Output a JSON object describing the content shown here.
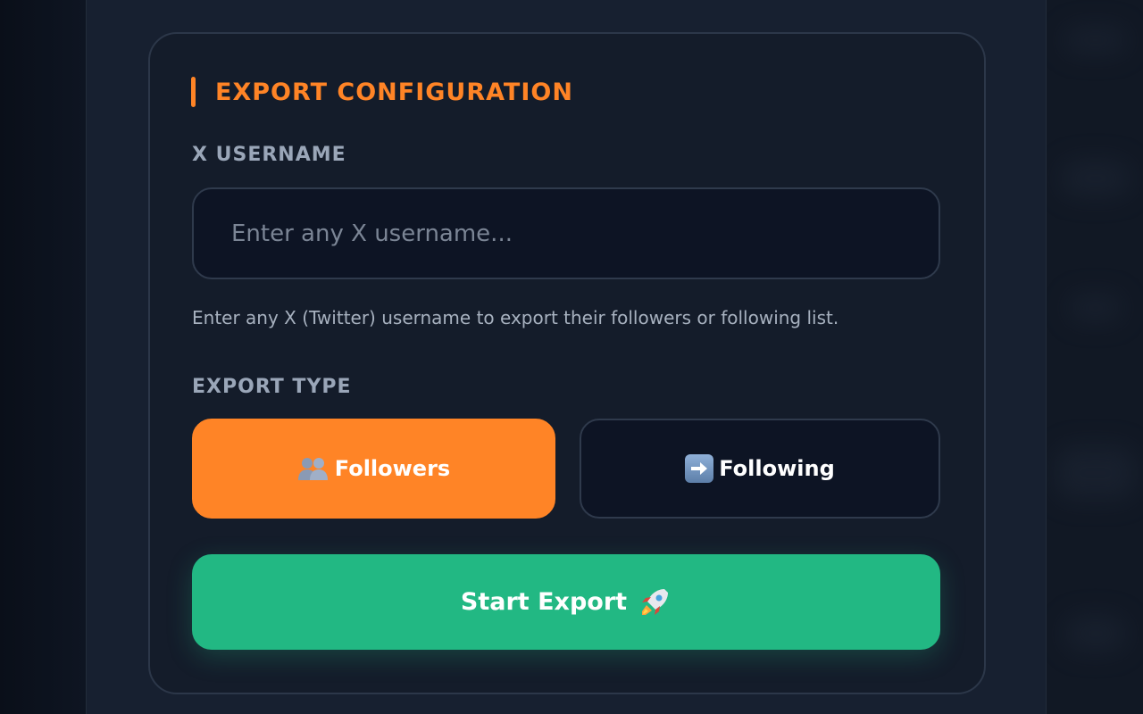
{
  "config": {
    "section_title": "EXPORT CONFIGURATION",
    "username_label": "X USERNAME",
    "username_placeholder": "Enter any X username...",
    "username_value": "",
    "username_hint": "Enter any X (Twitter) username to export their followers or following list.",
    "export_type_label": "EXPORT TYPE",
    "export_types": [
      {
        "label": "Followers",
        "icon": "people-icon",
        "selected": true
      },
      {
        "label": "Following",
        "icon": "right-arrow-icon",
        "selected": false
      }
    ],
    "start_button": {
      "label": "Start Export",
      "icon": "rocket-icon"
    }
  },
  "colors": {
    "accent": "#ff8426",
    "primary_action": "#22b883",
    "background": "#0b111c",
    "panel": "#172030",
    "card": "#141c2a",
    "input_bg": "#0d1424"
  }
}
